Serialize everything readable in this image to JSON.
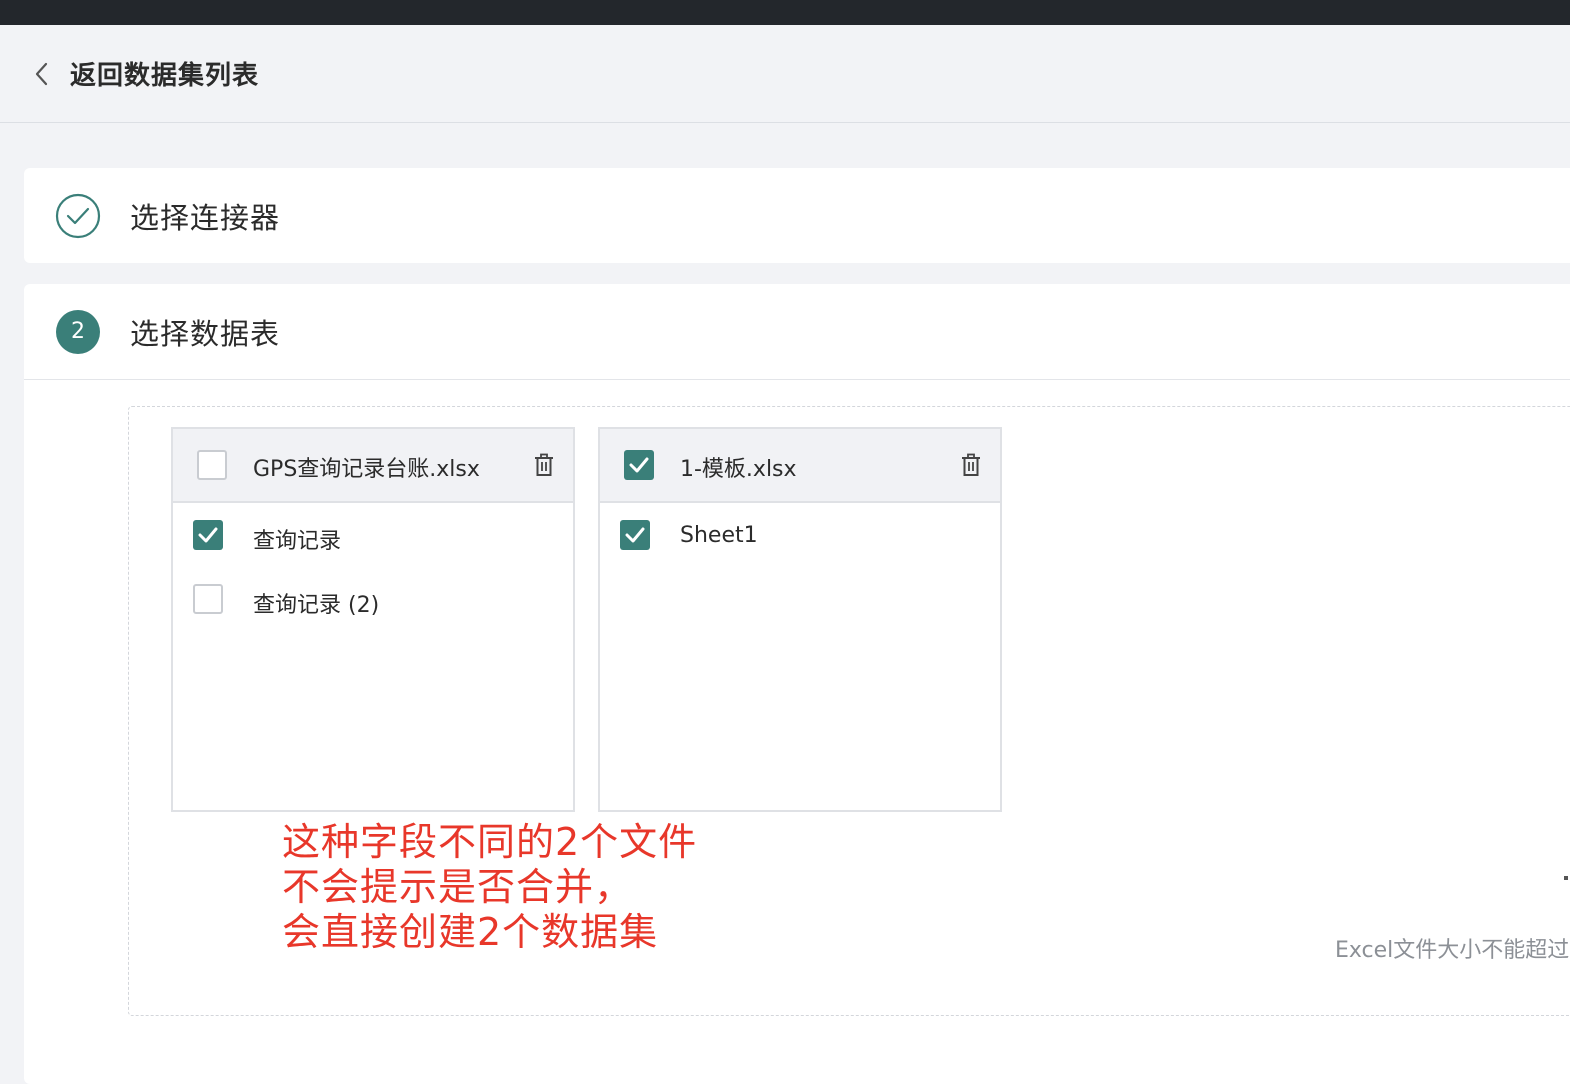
{
  "header": {
    "back_label": "返回数据集列表"
  },
  "steps": [
    {
      "title": "选择连接器",
      "status": "done"
    },
    {
      "number": "2",
      "title": "选择数据表",
      "status": "active"
    }
  ],
  "files": [
    {
      "name": "GPS查询记录台账.xlsx",
      "checked": false,
      "sheets": [
        {
          "name": "查询记录",
          "checked": true
        },
        {
          "name": "查询记录 (2)",
          "checked": false
        }
      ]
    },
    {
      "name": "1-模板.xlsx",
      "checked": true,
      "sheets": [
        {
          "name": "Sheet1",
          "checked": true
        }
      ]
    }
  ],
  "annotation": {
    "lines": [
      "这种字段不同的2个文件",
      "不会提示是否合并，",
      "会直接创建2个数据集"
    ]
  },
  "hint": "Excel文件大小不能超过",
  "colors": {
    "accent": "#3a7f79",
    "annotation": "#e8372a",
    "topbar": "#23272c"
  }
}
